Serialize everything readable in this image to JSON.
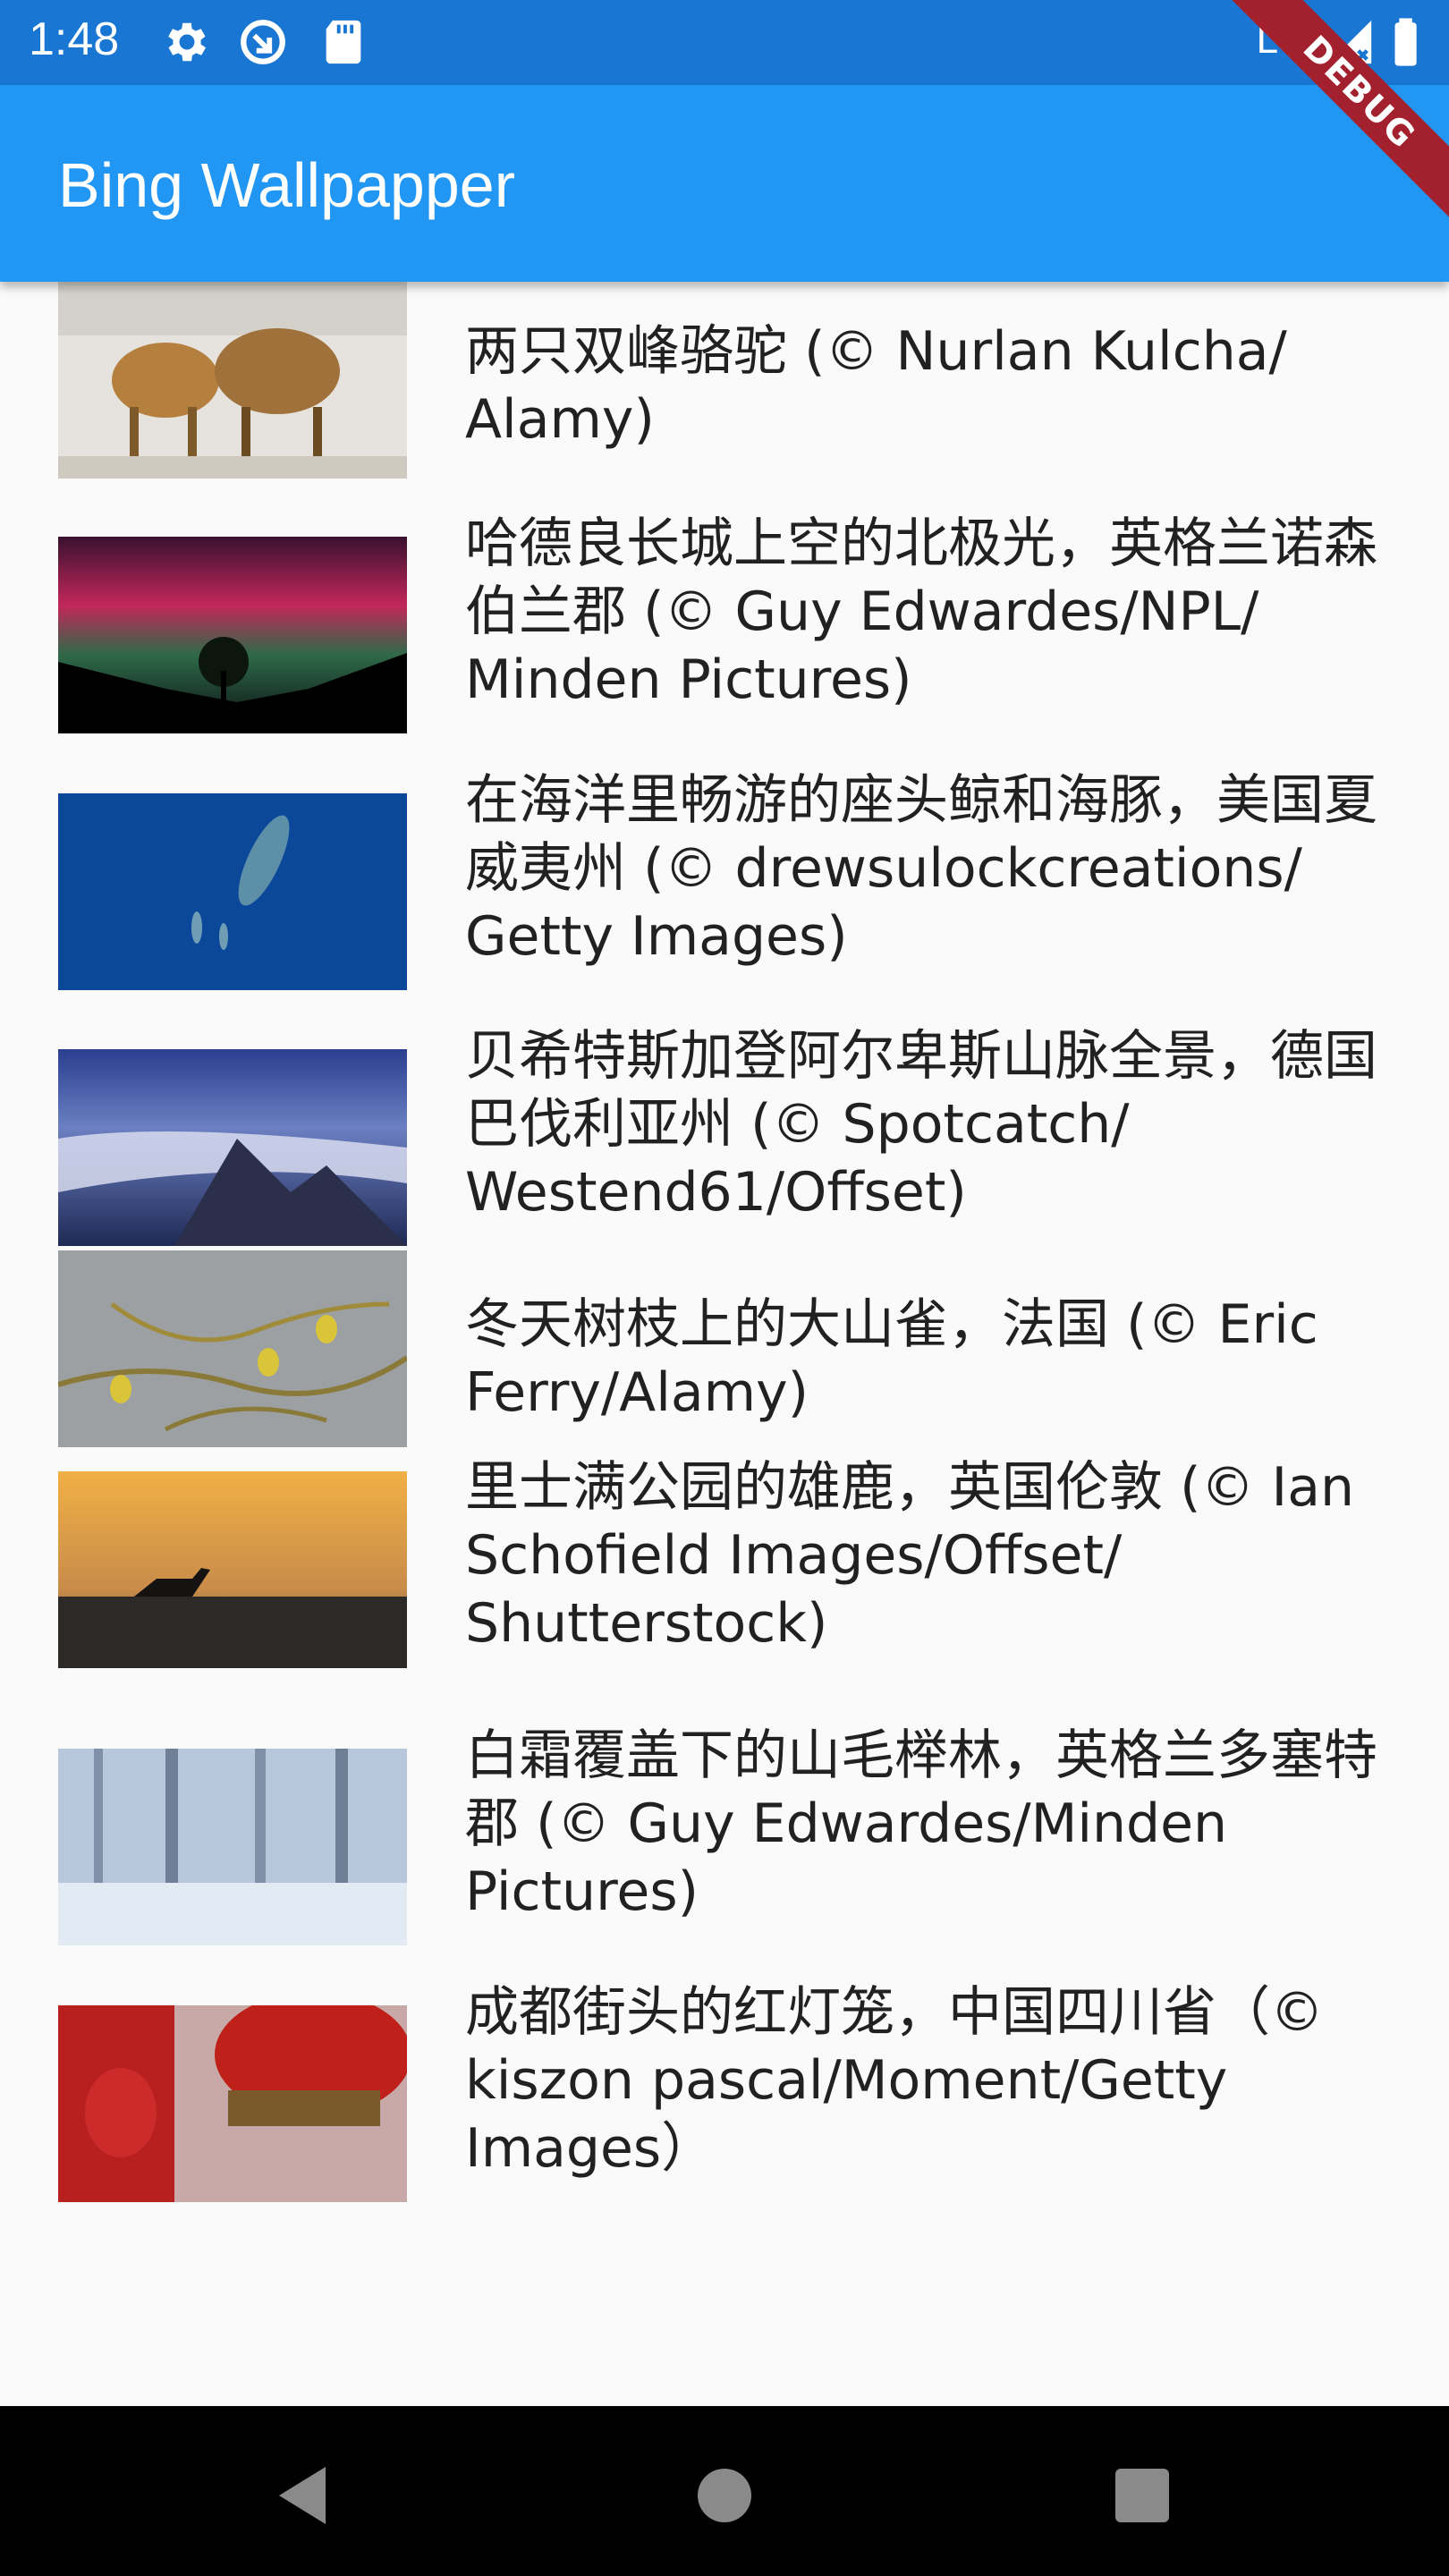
{
  "status_bar": {
    "time": "1:48",
    "network": "LTE"
  },
  "app_bar": {
    "title": "Bing Wallpapper",
    "debug_banner": "DEBUG"
  },
  "wallpapers": [
    {
      "caption": "两只双峰骆驼 (© Nurlan Kulcha/ Alamy)"
    },
    {
      "caption": "哈德良长城上空的北极光，英格兰诺森伯兰郡 (© Guy Edwardes/NPL/ Minden Pictures)"
    },
    {
      "caption": "在海洋里畅游的座头鲸和海豚，美国夏威夷州 (© drewsulockcreations/ Getty Images)"
    },
    {
      "caption": "贝希特斯加登阿尔卑斯山脉全景，德国巴伐利亚州 (© Spotcatch/ Westend61/Offset)"
    },
    {
      "caption": "冬天树枝上的大山雀，法国 (© Eric Ferry/Alamy)"
    },
    {
      "caption": "里士满公园的雄鹿，英国伦敦 (© Ian Schofield Images/Offset/ Shutterstock)"
    },
    {
      "caption": "白霜覆盖下的山毛榉林，英格兰多塞特郡 (© Guy Edwardes/Minden Pictures)"
    },
    {
      "caption": "成都街头的红灯笼，中国四川省（© kiszon pascal/Moment/Getty Images）"
    }
  ],
  "icons": {
    "status": [
      "gear-icon",
      "sync-icon",
      "sd-card-icon",
      "signal-icon",
      "battery-icon"
    ],
    "navigation": [
      "back-icon",
      "home-icon",
      "recents-icon"
    ]
  },
  "colors": {
    "status_bar": "#1976d2",
    "app_bar": "#2196f3",
    "nav_bar": "#000000",
    "background": "#fafafa",
    "debug_ribbon": "#a3212e"
  }
}
